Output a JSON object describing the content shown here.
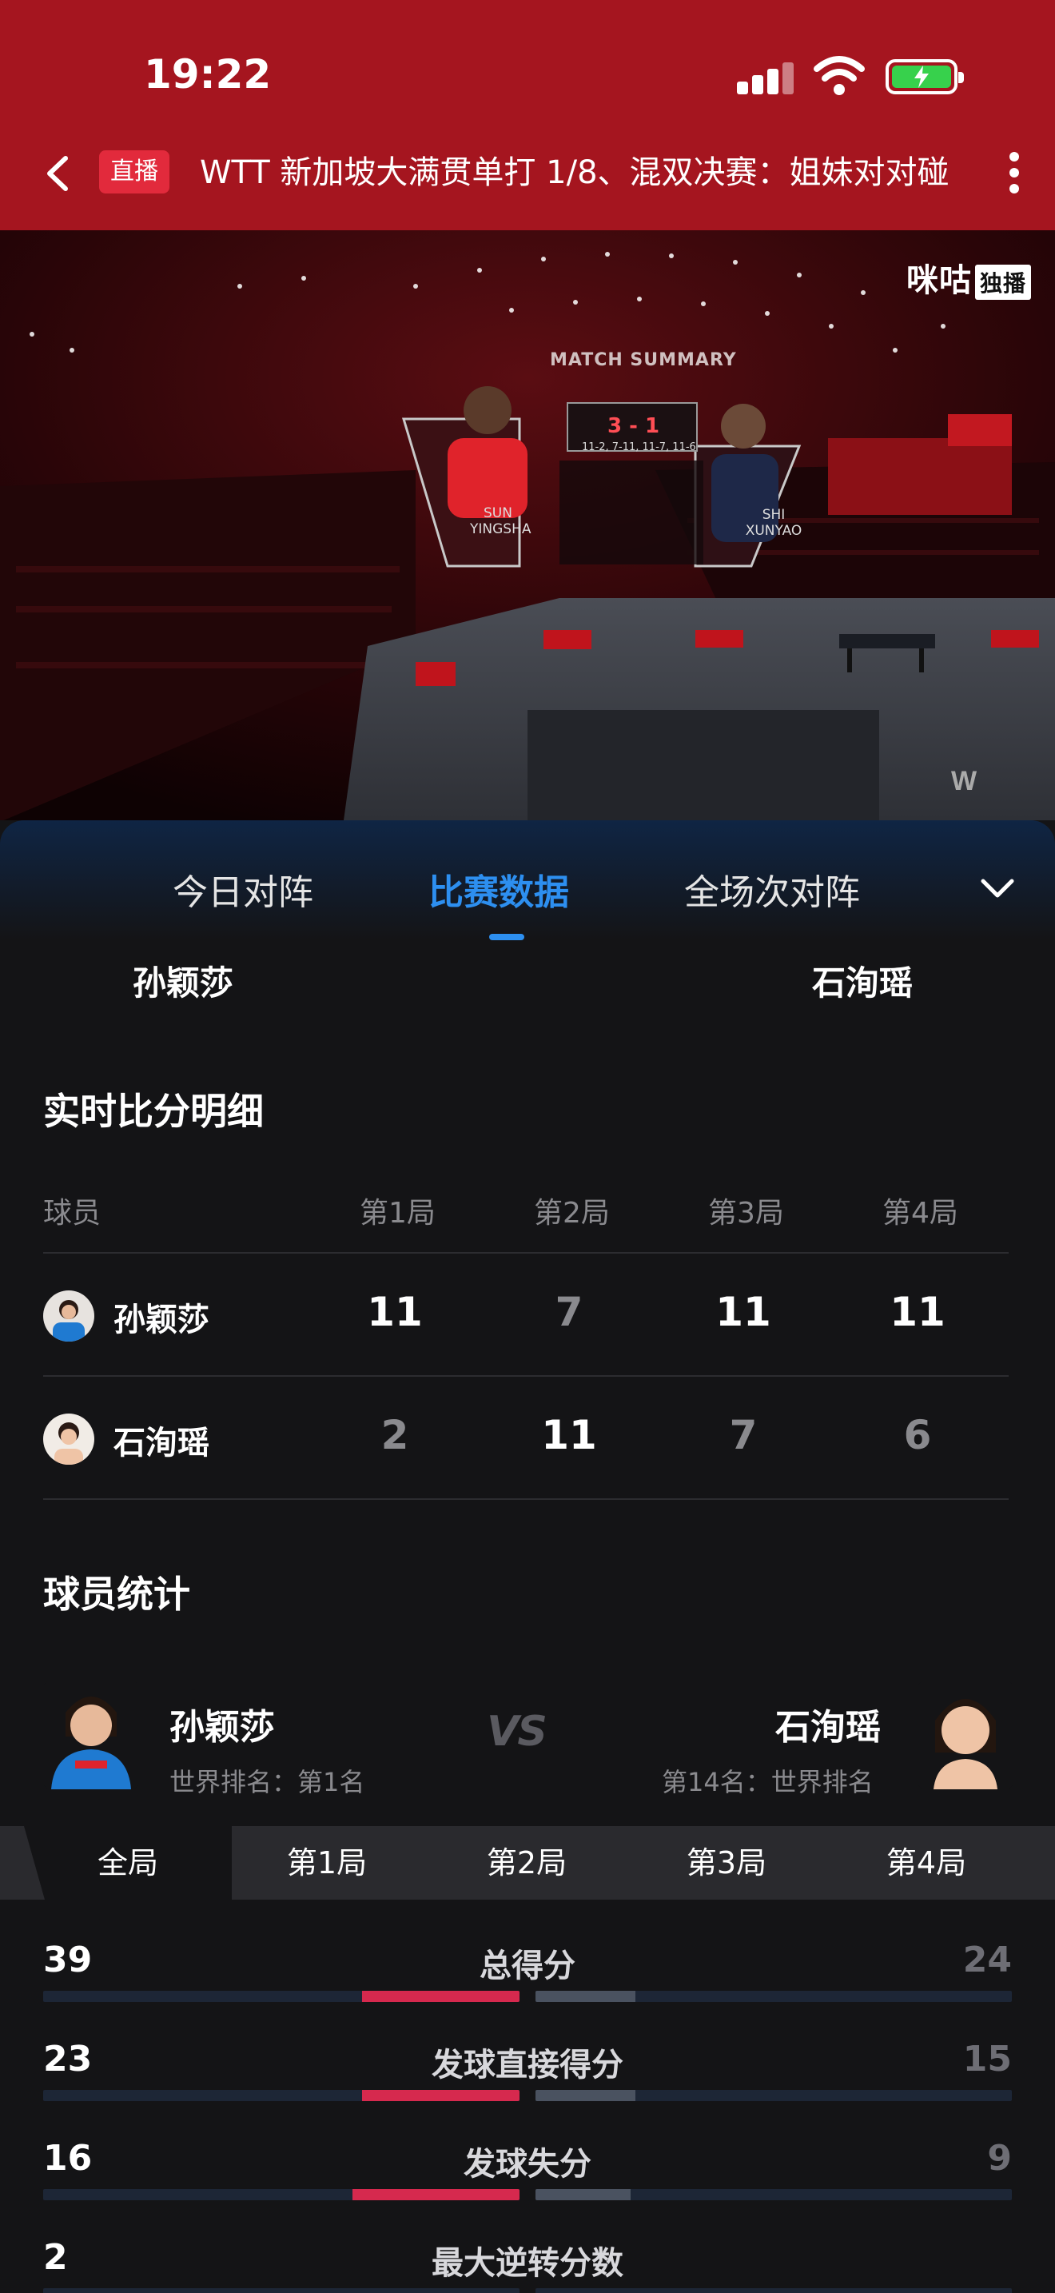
{
  "status_bar": {
    "time": "19:22"
  },
  "header": {
    "live_badge": "直播",
    "title": "WTT 新加坡大满贯单打 1/8、混双决赛：姐妹对对碰"
  },
  "video": {
    "watermark": "咪咕",
    "watermark_tag": "独播",
    "board_title": "MATCH SUMMARY",
    "board_score": "3 - 1",
    "board_sets": "11-2, 7-11, 11-7, 11-6",
    "player1": "SUN YINGSHA",
    "player2": "SHI XUNYAO"
  },
  "tabs": {
    "items": [
      "今日对阵",
      "比赛数据",
      "全场次对阵"
    ],
    "active": "比赛数据"
  },
  "players_header": {
    "left": "孙颖莎",
    "right": "石洵瑶"
  },
  "score_detail": {
    "title": "实时比分明细",
    "header": {
      "player": "球员",
      "games": [
        "第1局",
        "第2局",
        "第3局",
        "第4局"
      ]
    },
    "rows": [
      {
        "name": "孙颖莎",
        "scores": [
          "11",
          "7",
          "11",
          "11"
        ]
      },
      {
        "name": "石洵瑶",
        "scores": [
          "2",
          "11",
          "7",
          "6"
        ]
      }
    ]
  },
  "player_stats": {
    "title": "球员统计",
    "left": {
      "name": "孙颖莎",
      "rank": "世界排名：第1名"
    },
    "right": {
      "name": "石洵瑶",
      "rank": "第14名：世界排名"
    },
    "vs": "VS",
    "round_tabs": [
      "全局",
      "第1局",
      "第2局",
      "第3局",
      "第4局"
    ],
    "active_round": "全局",
    "rows": [
      {
        "label": "总得分",
        "left": "39",
        "right": "24",
        "left_ratio": 0.33,
        "right_ratio": 0.21
      },
      {
        "label": "发球直接得分",
        "left": "23",
        "right": "15",
        "left_ratio": 0.33,
        "right_ratio": 0.21
      },
      {
        "label": "发球失分",
        "left": "16",
        "right": "9",
        "left_ratio": 0.35,
        "right_ratio": 0.2
      },
      {
        "label": "最大逆转分数",
        "left": "2",
        "right": "",
        "left_ratio": 0,
        "right_ratio": 0
      }
    ]
  }
}
